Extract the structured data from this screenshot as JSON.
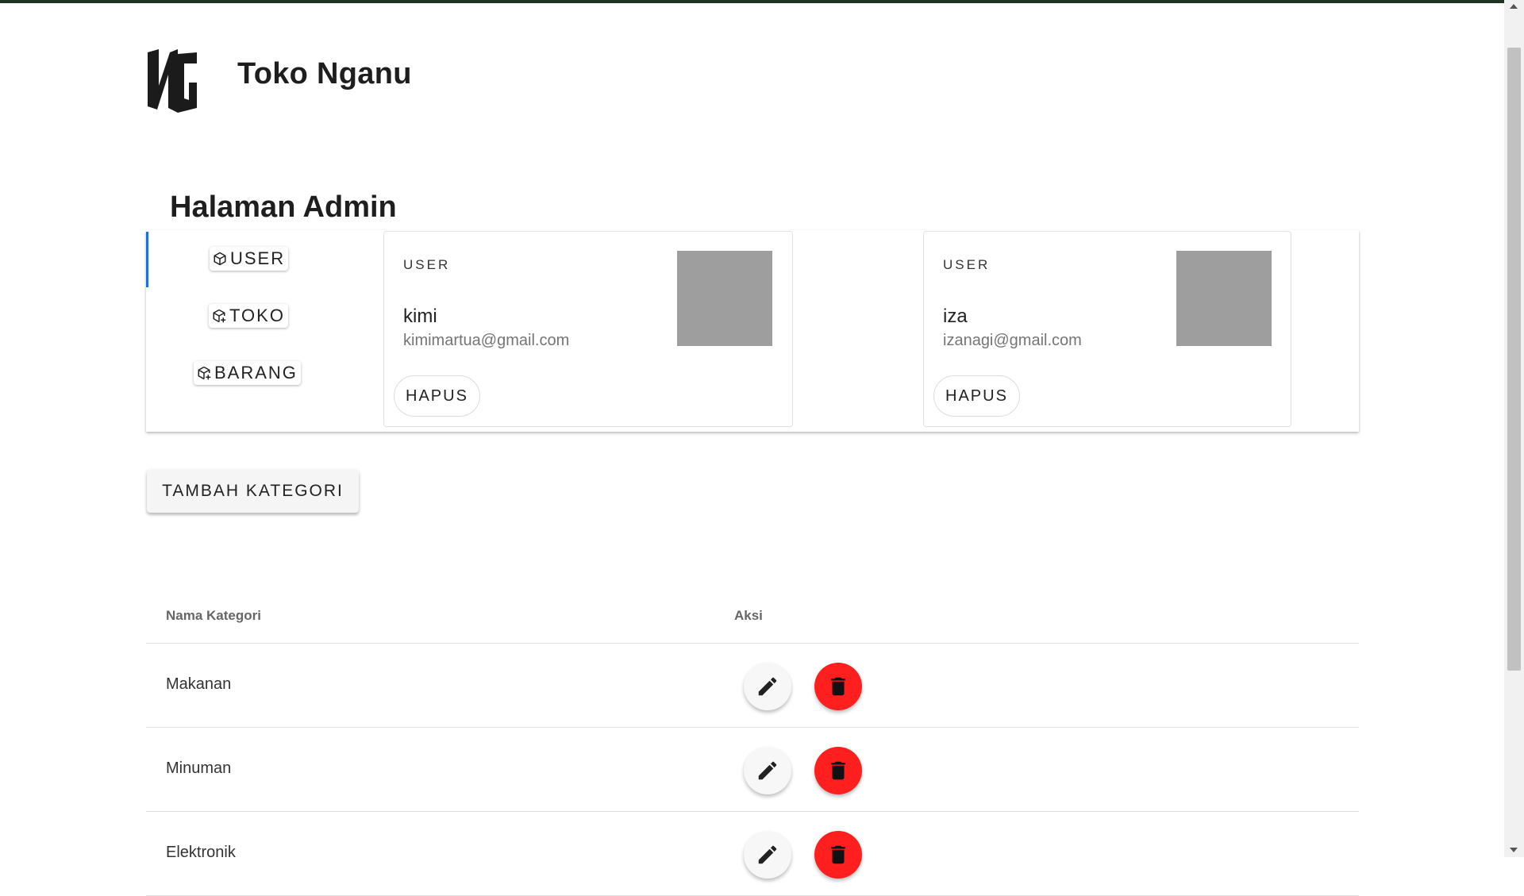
{
  "header": {
    "brand": "Toko Nganu",
    "logo_text": "NG"
  },
  "page_title": "Halaman Admin",
  "tabs": [
    {
      "label": "USER",
      "icon": "box-icon",
      "active": true
    },
    {
      "label": "TOKO",
      "icon": "box-plus-icon",
      "active": false
    },
    {
      "label": "BARANG",
      "icon": "box-plus-icon",
      "active": false
    }
  ],
  "users": [
    {
      "overline": "USER",
      "name": "kimi",
      "email": "kimimartua@gmail.com",
      "action": "HAPUS"
    },
    {
      "overline": "USER",
      "name": "iza",
      "email": "izanagi@gmail.com",
      "action": "HAPUS"
    }
  ],
  "add_category_label": "TAMBAH KATEGORI",
  "table": {
    "headers": {
      "name": "Nama Kategori",
      "aksi": "Aksi"
    },
    "rows": [
      {
        "name": "Makanan"
      },
      {
        "name": "Minuman"
      },
      {
        "name": "Elektronik"
      }
    ]
  },
  "colors": {
    "delete": "#ff1f1f",
    "active_tab": "#1e6fd9",
    "top_bar": "#1f3320",
    "thumbnail": "#9e9e9e"
  }
}
